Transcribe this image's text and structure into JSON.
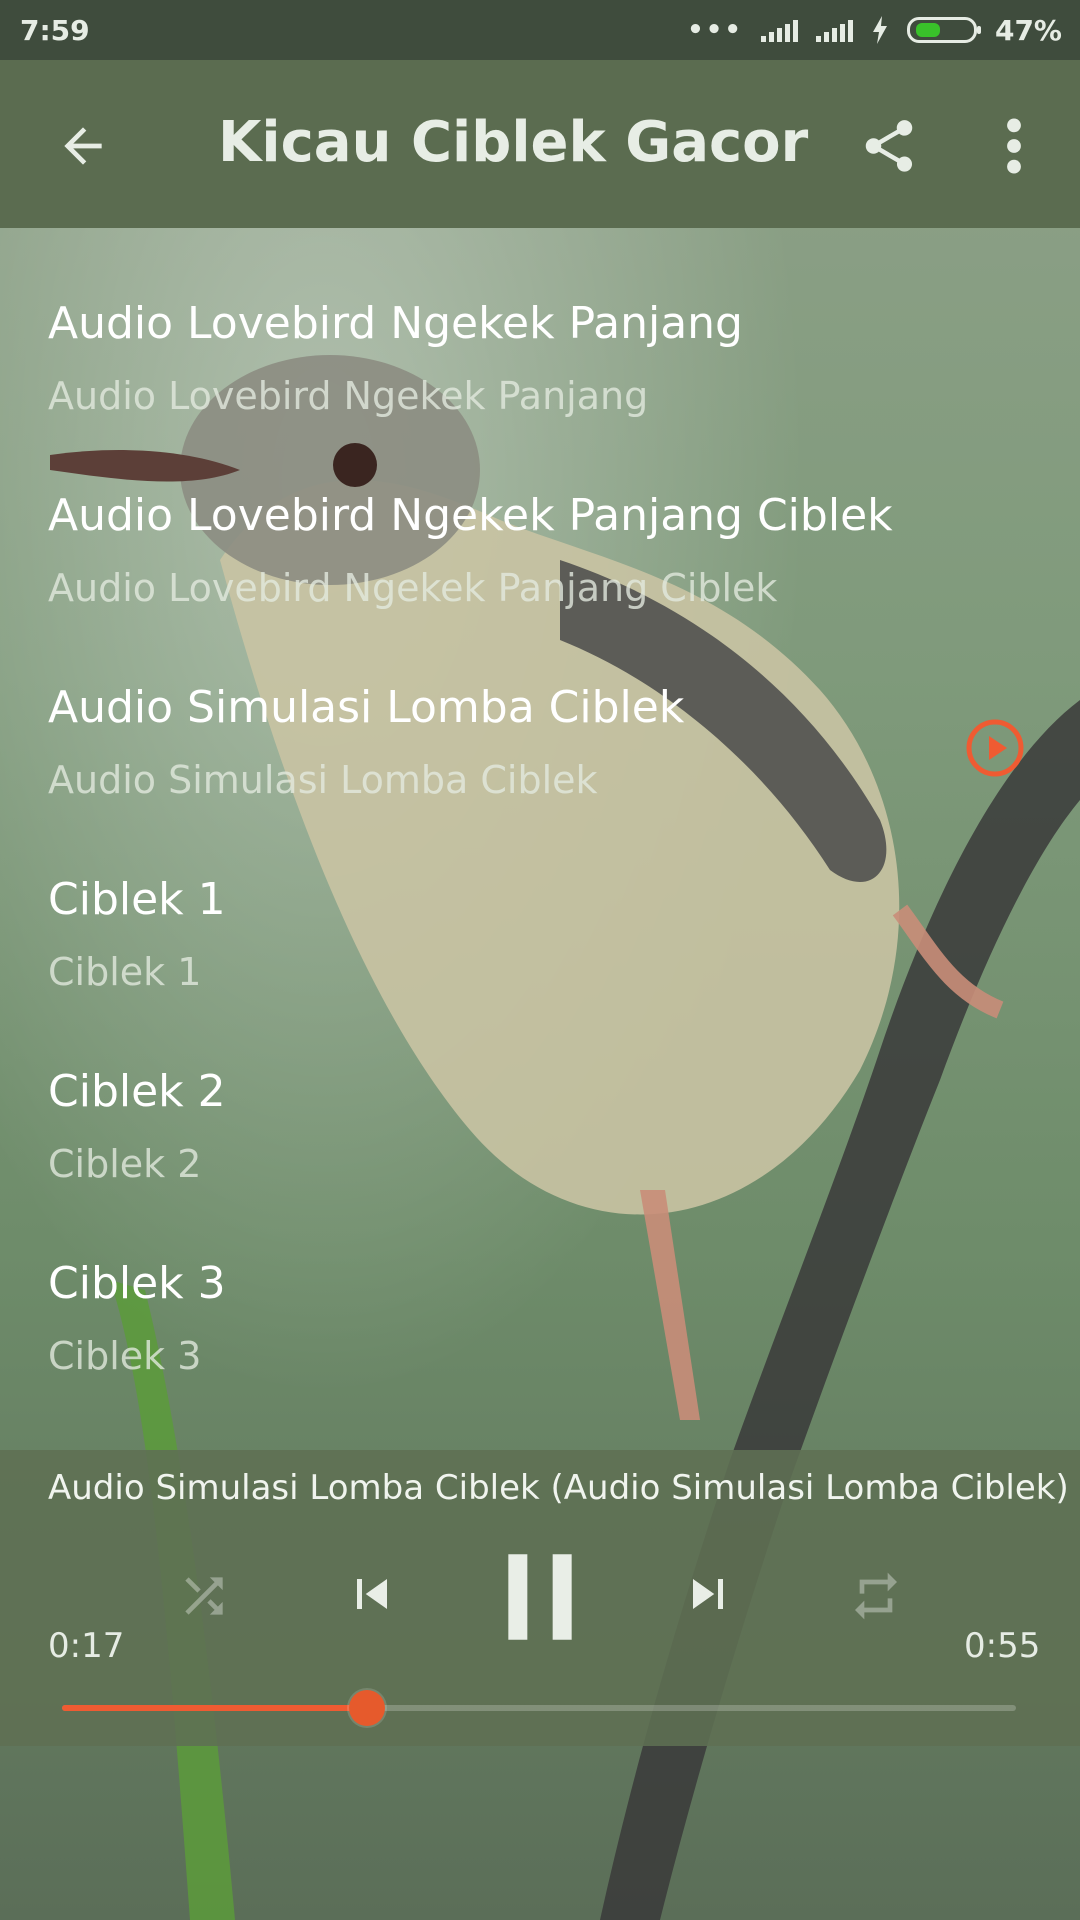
{
  "status_bar": {
    "time": "7:59",
    "dots": "•••",
    "battery_percent": "47%",
    "battery_level": 0.47
  },
  "toolbar": {
    "title": "Kicau Ciblek Gacor",
    "icons": [
      "back-arrow-icon",
      "share-icon",
      "more-vert-icon"
    ]
  },
  "playlist": {
    "items": [
      {
        "title": "Audio Lovebird Ngekek Panjang",
        "subtitle": "Audio Lovebird Ngekek Panjang"
      },
      {
        "title": "Audio Lovebird Ngekek Panjang Ciblek",
        "subtitle": "Audio Lovebird Ngekek Panjang Ciblek"
      },
      {
        "title": "Audio Simulasi Lomba Ciblek",
        "subtitle": "Audio Simulasi Lomba Ciblek",
        "playing": true
      },
      {
        "title": "Ciblek 1",
        "subtitle": "Ciblek 1"
      },
      {
        "title": "Ciblek 2",
        "subtitle": "Ciblek 2"
      },
      {
        "title": "Ciblek 3",
        "subtitle": "Ciblek 3"
      }
    ]
  },
  "player": {
    "now_playing": "Audio Simulasi Lomba Ciblek (Audio Simulasi Lomba Ciblek)",
    "current_time": "0:17",
    "total_time": "0:55",
    "progress": 0.32,
    "controls": [
      "shuffle-icon",
      "skip-previous-icon",
      "pause-icon",
      "skip-next-icon",
      "repeat-icon"
    ]
  },
  "colors": {
    "toolbar": "#5b6c50",
    "status_bar": "#3f4c3d",
    "accent": "#ef5b32",
    "player_bg": "#5f7053"
  }
}
